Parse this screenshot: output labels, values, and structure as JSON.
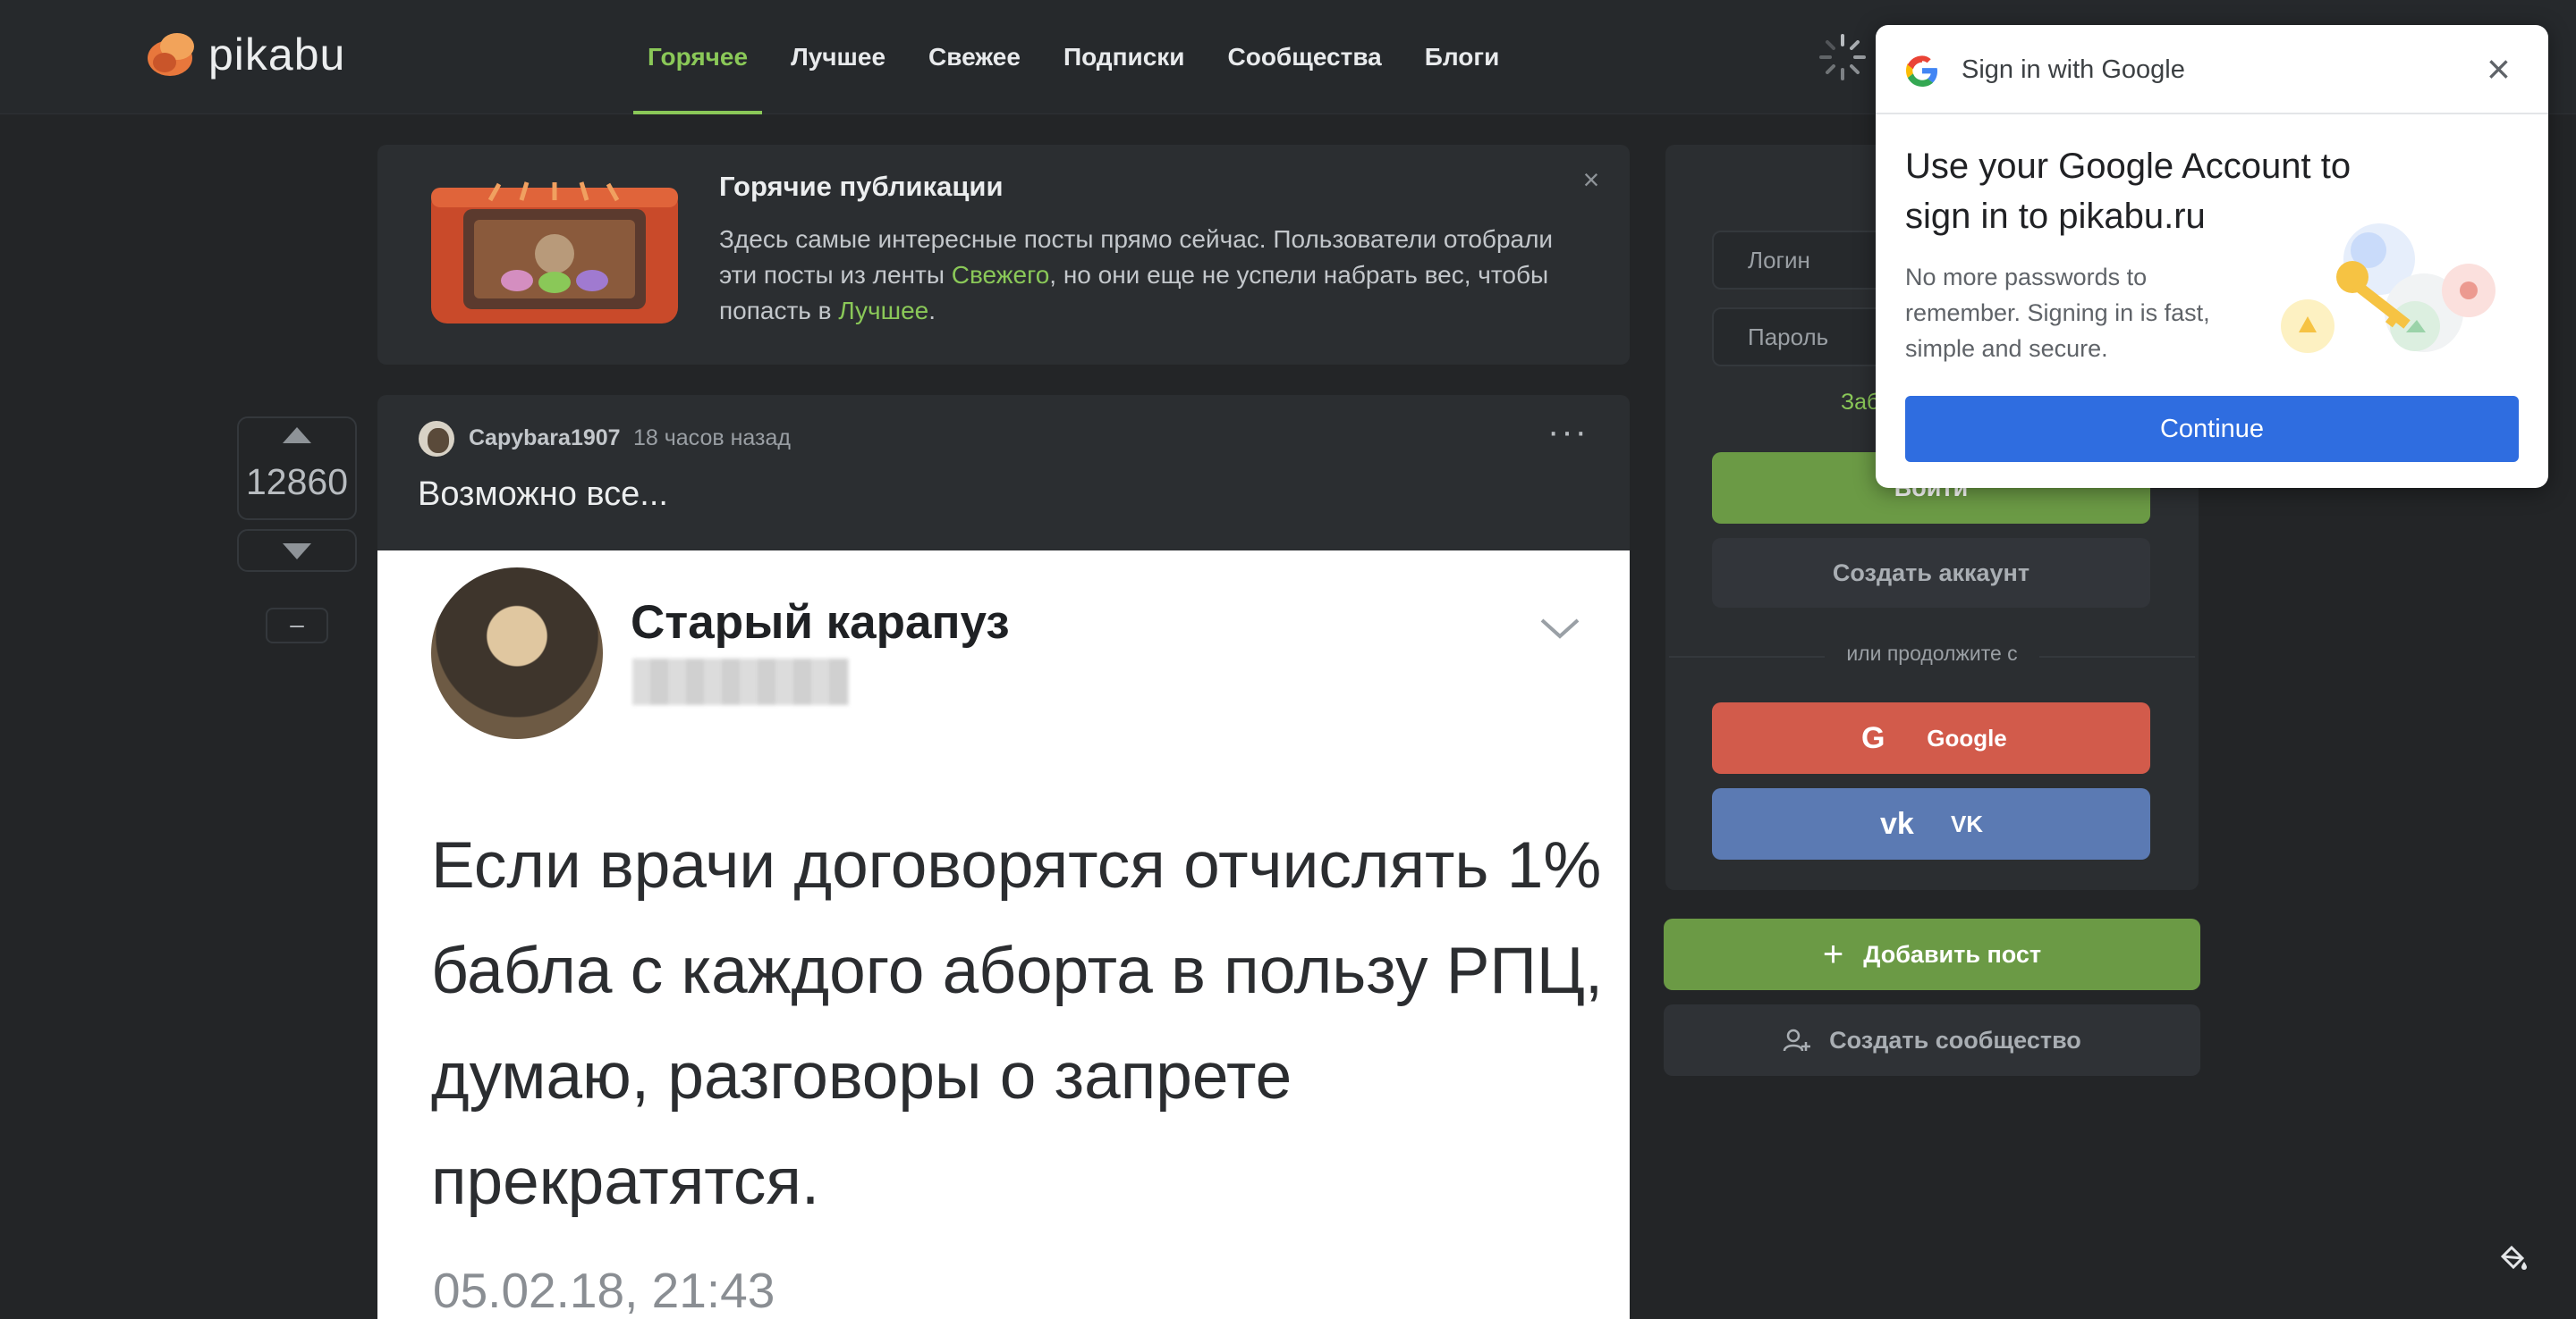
{
  "header": {
    "logo_text": "pikabu",
    "nav": [
      "Горячее",
      "Лучшее",
      "Свежее",
      "Подписки",
      "Сообщества",
      "Блоги"
    ],
    "active_nav": "Горячее"
  },
  "hot_banner": {
    "title": "Горячие публикации",
    "text_part1": "Здесь самые интересные посты прямо сейчас. Пользователи отобрали эти посты из ленты ",
    "link1": "Свежего",
    "text_part2": ", но они еще не успели набрать вес, чтобы попасть в ",
    "link2": "Лучшее",
    "text_part3": ".",
    "close": "×"
  },
  "post": {
    "rating": "12860",
    "minus": "–",
    "author": "Capybara1907",
    "time": "18 часов назад",
    "more": "···",
    "title": "Возможно все...",
    "tweet": {
      "name": "Старый карапуз",
      "text": "Если врачи договорятся отчислять 1% бабла с каждого аборта в пользу РПЦ, думаю, разговоры о запрете прекратятся.",
      "date": "05.02.18, 21:43"
    }
  },
  "auth": {
    "login_placeholder": "Логин",
    "password_placeholder": "Пароль",
    "forgot": "Заб",
    "login_button": "Войти",
    "create_account": "Создать аккаунт",
    "or_continue": "или продолжите с",
    "google": "Google",
    "vk": "VK",
    "add_post": "Добавить пост",
    "create_community": "Создать сообщество"
  },
  "google_popup": {
    "header_title": "Sign in with Google",
    "title": "Use your Google Account to sign in to pikabu.ru",
    "description": "No more passwords to remember. Signing in is fast, simple and secure.",
    "continue": "Continue"
  },
  "colors": {
    "accent_green": "#8ac858",
    "button_green": "#6b9a45",
    "google_red": "#d25b4b",
    "vk_blue": "#5b7ab3",
    "google_blue": "#2f6de0"
  }
}
